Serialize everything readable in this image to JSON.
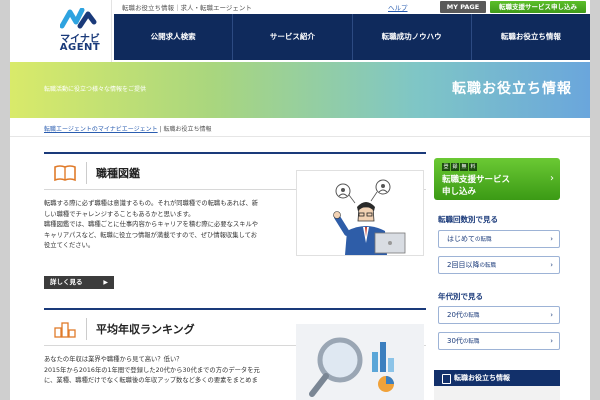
{
  "topbar": {
    "tagline": "転職お役立ち情報｜求人・転職エージェント",
    "help": "ヘルプ",
    "mypage": "MY PAGE",
    "apply": "転職支援サービス申し込み"
  },
  "logo": {
    "line1": "マイナビ",
    "line2": "AGENT"
  },
  "nav": [
    {
      "label": "公開求人検索"
    },
    {
      "label": "サービス紹介"
    },
    {
      "label": "転職成功ノウハウ"
    },
    {
      "label": "転職お役立ち情報"
    }
  ],
  "hero": {
    "subtitle": "転職活動に役立つ様々な情報をご提供",
    "title": "転職お役立ち情報"
  },
  "breadcrumb": {
    "home": "転職エージェントのマイナビエージェント",
    "separator": "|",
    "current": "転職お役立ち情報"
  },
  "sections": [
    {
      "title": "職種図鑑",
      "icon": "book-icon",
      "body": [
        "転職する際に必ず職種は意識するもの。それが同職種での転職もあれば、新",
        "しい職種でチャレンジすることもあるかと思います。",
        "職種図鑑では、職種ごとに仕事内容からキャリアを積む際に必要なスキルや",
        "キャリアパスなど、転職に役立つ情報が満載ですので、ぜひ情報収集してお",
        "役立てください。"
      ],
      "button": "詳しく見る"
    },
    {
      "title": "平均年収ランキング",
      "icon": "ranking-podium-icon",
      "body": [
        "あなたの年収は業界や職種から見て高い？低い？",
        "2015年から2016年の1年間で登録した20代から30代までの方のデータを元",
        "に、業種、職種だけでなく転職後の年収アップ数など多くの要素をまとめま"
      ]
    }
  ],
  "sidebar": {
    "apply": {
      "badges": [
        "登",
        "録",
        "無",
        "料"
      ],
      "line1": "転職支援サービス",
      "line2": "申し込み"
    },
    "by_count": {
      "heading": "転職回数別で見る",
      "items": [
        {
          "main": "はじめて",
          "sub": "の転職"
        },
        {
          "main": "2回目以降",
          "sub": "の転職"
        }
      ]
    },
    "by_age": {
      "heading": "年代別で見る",
      "items": [
        {
          "main": "20代",
          "sub": "の転職"
        },
        {
          "main": "30代",
          "sub": "の転職"
        }
      ]
    },
    "info": "転職お役立ち情報"
  },
  "colors": {
    "navy": "#0f2a5c",
    "green": "#4caf24",
    "link": "#2a5db0"
  }
}
